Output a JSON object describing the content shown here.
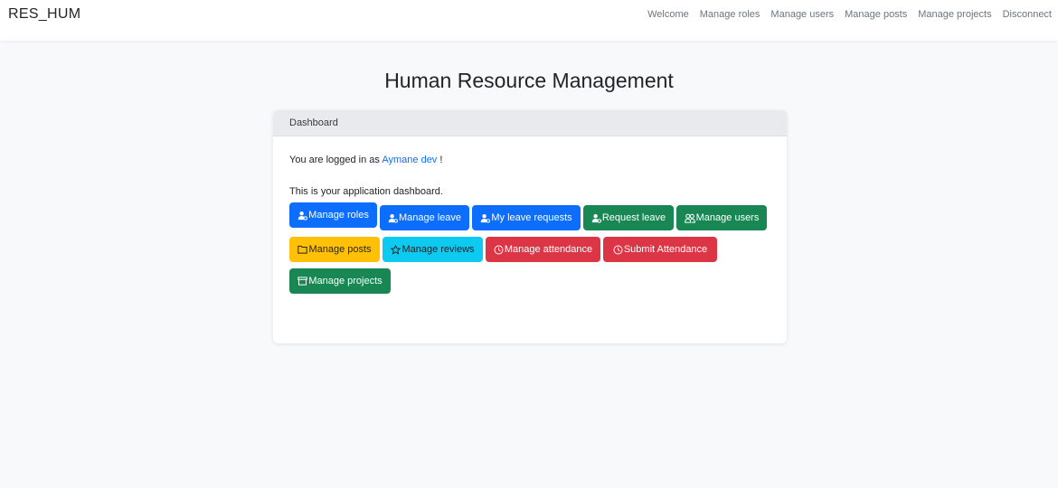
{
  "navbar": {
    "brand": "RES_HUM",
    "links": [
      "Welcome",
      "Manage roles",
      "Manage users",
      "Manage posts",
      "Manage projects",
      "Disconnect"
    ]
  },
  "page": {
    "title": "Human Resource Management"
  },
  "card": {
    "header": "Dashboard",
    "logged_prefix": "You are logged in as ",
    "user_name": "Aymane dev",
    "logged_suffix": " !",
    "dashboard_text": "This is your application dashboard."
  },
  "buttons": [
    {
      "label": "Manage roles",
      "style": "primary",
      "icon": "user-gear-icon"
    },
    {
      "label": "Manage leave",
      "style": "primary",
      "icon": "user-gear-icon"
    },
    {
      "label": "My leave requests",
      "style": "primary",
      "icon": "user-gear-icon"
    },
    {
      "label": "Request leave",
      "style": "success",
      "icon": "user-gear-icon"
    },
    {
      "label": "Manage users",
      "style": "success",
      "icon": "users-icon"
    },
    {
      "label": "Manage posts",
      "style": "warning",
      "icon": "folder-icon"
    },
    {
      "label": "Manage reviews",
      "style": "info",
      "icon": "star-icon"
    },
    {
      "label": "Manage attendance",
      "style": "danger",
      "icon": "clock-icon"
    },
    {
      "label": "Submit Attendance",
      "style": "danger",
      "icon": "clock-icon"
    },
    {
      "label": "Manage projects",
      "style": "success",
      "icon": "archive-icon"
    }
  ],
  "colors": {
    "primary": "#0d6efd",
    "success": "#198754",
    "warning": "#ffc107",
    "info": "#0dcaf0",
    "danger": "#dc3545",
    "link": "#0d6efd"
  }
}
